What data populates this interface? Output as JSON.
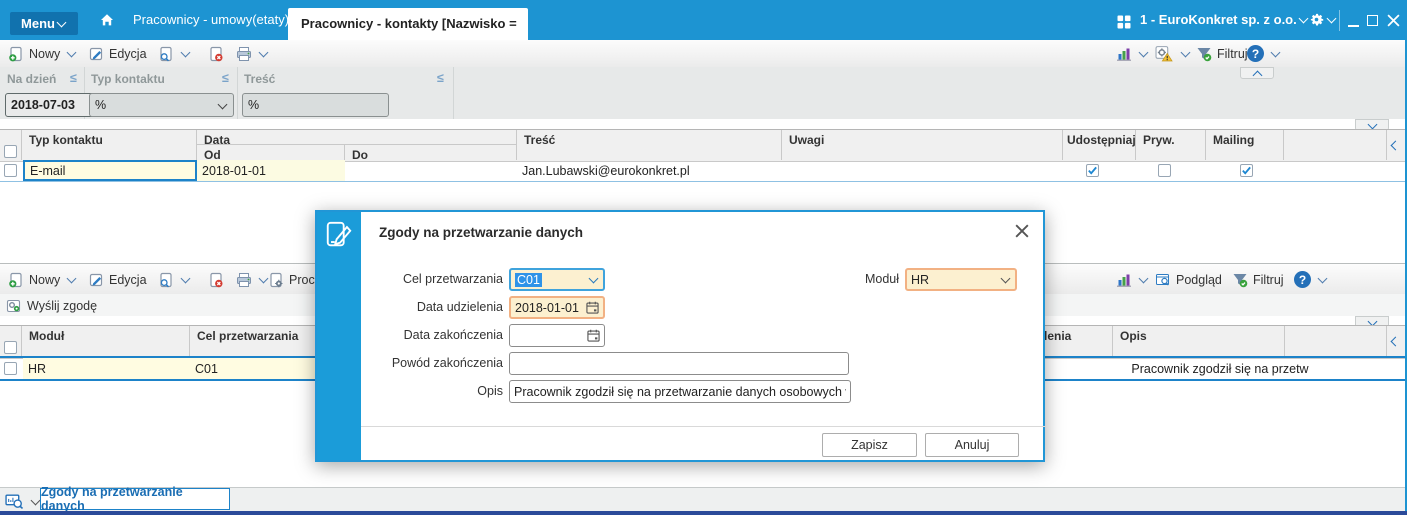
{
  "topbar": {
    "menu_label": "Menu",
    "tabs": [
      {
        "label": "Pracownicy - umowy(etaty)",
        "active": false
      },
      {
        "label": "Pracownicy - kontakty [Nazwisko =",
        "active": true
      }
    ],
    "company_selector": "1 - EuroKonkret sp. z o.o.",
    "window_controls": [
      "minimize",
      "maximize",
      "close"
    ]
  },
  "toolbar1": {
    "new": "Nowy",
    "edit": "Edycja",
    "filter": "Filtruj"
  },
  "filters": {
    "fields": [
      {
        "label": "Na dzień",
        "op": "≤",
        "value": "2018-07-03",
        "type": "date"
      },
      {
        "label": "Typ kontaktu",
        "op": "≤",
        "value": "%",
        "type": "select"
      },
      {
        "label": "Treść",
        "op": "≤",
        "value": "%",
        "type": "text"
      }
    ]
  },
  "grid1": {
    "columns": {
      "typ": "Typ kontaktu",
      "data": "Data",
      "od": "Od",
      "do": "Do",
      "tresc": "Treść",
      "uwagi": "Uwagi",
      "udostepniaj": "Udostępniaj",
      "pryw": "Pryw.",
      "mailing": "Mailing"
    },
    "row": {
      "typ": "E-mail",
      "od": "2018-01-01",
      "do": "",
      "tresc": "Jan.Lubawski@eurokonkret.pl",
      "udostepniaj": true,
      "pryw": false,
      "mailing": true
    }
  },
  "toolbar2": {
    "new": "Nowy",
    "edit": "Edycja",
    "proced": "Proced",
    "send": "Wyślij zgodę",
    "preview": "Podgląd",
    "filter": "Filtruj"
  },
  "grid2": {
    "columns": {
      "modul": "Moduł",
      "cel": "Cel przetwarzania",
      "data_udzielenia": "Data udzielenia",
      "opis": "Opis"
    },
    "row": {
      "modul": "HR",
      "cel": "C01",
      "opis": "Pracownik zgodził się na przetw"
    }
  },
  "modal": {
    "title": "Zgody na przetwarzanie danych",
    "labels": {
      "cel": "Cel przetwarzania",
      "modul": "Moduł",
      "data_udzielenia": "Data udzielenia",
      "data_zakonczenia": "Data zakończenia",
      "powod": "Powód zakończenia",
      "opis": "Opis"
    },
    "values": {
      "cel": "C01",
      "modul": "HR",
      "data_udzielenia": "2018-01-01",
      "data_zakonczenia": "",
      "powod": "",
      "opis": "Pracownik zgodził się na przetwarzanie danych osobowych w związ"
    },
    "buttons": {
      "save": "Zapisz",
      "cancel": "Anuluj"
    }
  },
  "bottombar": {
    "tab": "Zgody na przetwarzanie danych"
  },
  "glyphs": {
    "help": "?"
  },
  "colors": {
    "topbar": "#1d94d2",
    "menu_button": "#1172ae",
    "selection_border": "#1d83c9",
    "row_highlight": "#fffce1",
    "field_cream": "#fcf0d0",
    "field_focus_border": "#3fa3dc",
    "field_required_border": "#f2b183",
    "modal_stripe": "#1b9cd9",
    "navy_strip": "#2b4a99"
  }
}
